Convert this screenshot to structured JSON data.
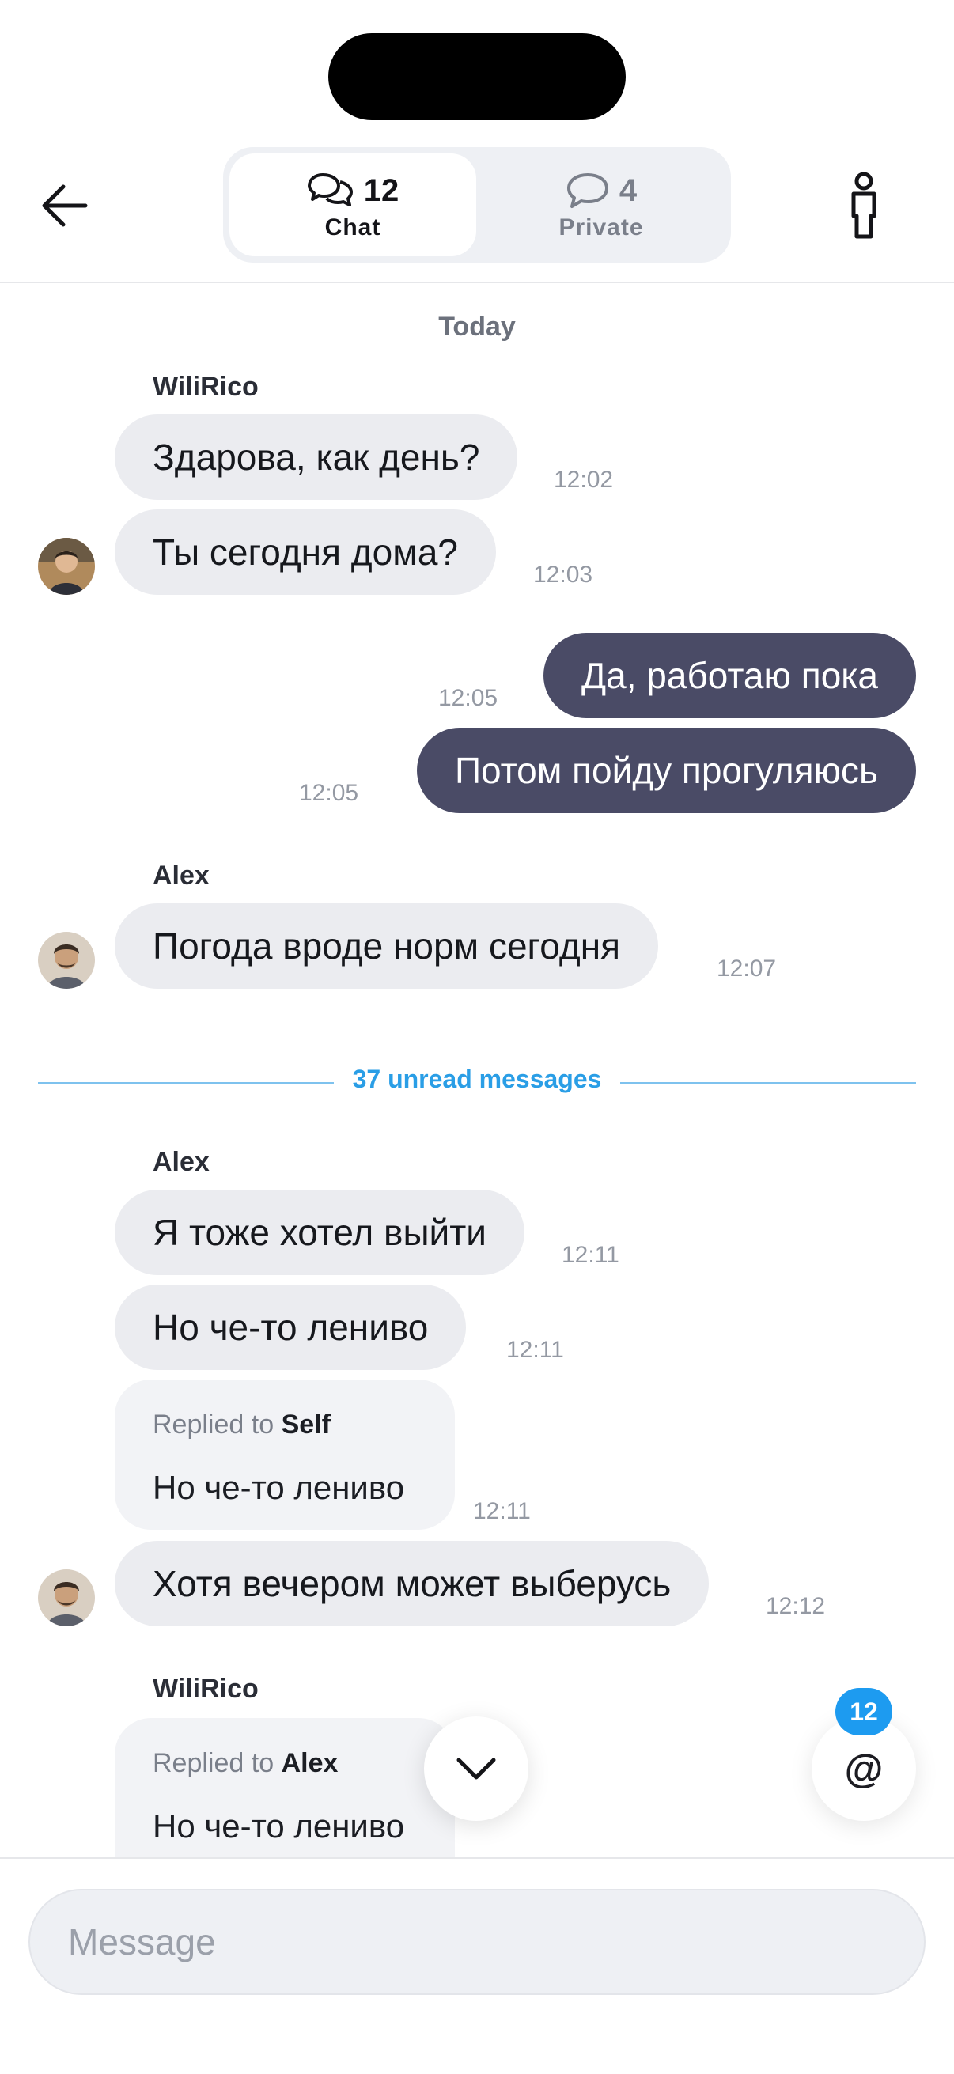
{
  "header": {
    "tabs": [
      {
        "label": "Chat",
        "count": "12",
        "active": true
      },
      {
        "label": "Private",
        "count": "4",
        "active": false
      }
    ]
  },
  "chat": {
    "day_label": "Today",
    "unread_divider": "37 unread messages",
    "groups": [
      {
        "sender": "WiliRico",
        "messages": [
          {
            "text": "Здарова, как день?",
            "time": "12:02"
          },
          {
            "text": "Ты сегодня дома?",
            "time": "12:03"
          }
        ]
      },
      {
        "sender": "self",
        "messages": [
          {
            "text": "Да, работаю пока",
            "time": "12:05"
          },
          {
            "text": "Потом пойду прогуляюсь",
            "time": "12:05"
          }
        ]
      },
      {
        "sender": "Alex",
        "messages": [
          {
            "text": "Погода вроде норм сегодня",
            "time": "12:07"
          }
        ]
      },
      {
        "sender": "Alex",
        "messages": [
          {
            "text": "Я тоже хотел выйти",
            "time": "12:11"
          },
          {
            "text": "Но че-то лениво",
            "time": "12:11"
          },
          {
            "reply_prefix": "Replied to",
            "reply_to": "Self",
            "text": "Но че-то лениво",
            "time": "12:11"
          },
          {
            "text": "Хотя вечером может выберусь",
            "time": "12:12"
          }
        ]
      },
      {
        "sender": "WiliRico",
        "messages": [
          {
            "reply_prefix": "Replied to",
            "reply_to": "Alex",
            "text": "Но че-то лениво",
            "time": ""
          }
        ]
      }
    ]
  },
  "mentions": {
    "badge_count": "12",
    "symbol": "@"
  },
  "composer": {
    "placeholder": "Message",
    "value": ""
  },
  "colors": {
    "accent": "#1d9bf0",
    "outgoing_bubble": "#4a4b66",
    "incoming_bubble": "#ebecf0"
  },
  "icons": {
    "back": "arrow-left-icon",
    "chat_tab": "chat-bubbles-icon",
    "private_tab": "chat-bubble-icon",
    "profile": "person-icon",
    "scroll_down": "chevron-down-icon"
  }
}
